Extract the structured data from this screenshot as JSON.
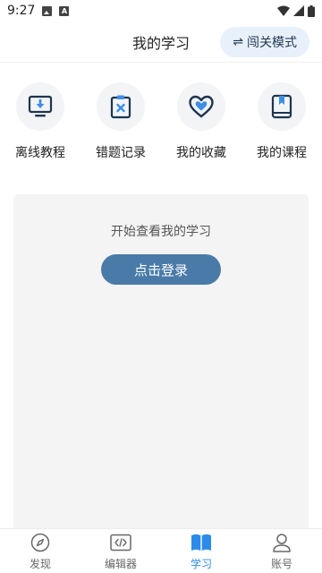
{
  "status_bar": {
    "time": "9:27"
  },
  "header": {
    "title": "我的学习",
    "mode_button_label": "闯关模式"
  },
  "quick_actions": [
    {
      "label": "离线教程",
      "icon": "download-screen-icon"
    },
    {
      "label": "错题记录",
      "icon": "clipboard-x-icon"
    },
    {
      "label": "我的收藏",
      "icon": "heart-icon"
    },
    {
      "label": "我的课程",
      "icon": "book-icon"
    }
  ],
  "login_card": {
    "hint": "开始查看我的学习",
    "button_label": "点击登录"
  },
  "bottom_nav": {
    "items": [
      {
        "label": "发现",
        "icon": "compass-icon",
        "active": false
      },
      {
        "label": "编辑器",
        "icon": "code-icon",
        "active": false
      },
      {
        "label": "学习",
        "icon": "book-open-icon",
        "active": true
      },
      {
        "label": "账号",
        "icon": "user-icon",
        "active": false
      }
    ]
  },
  "colors": {
    "accent": "#2c8be8",
    "login_button": "#4a7ba8",
    "mode_button_bg": "#e8f1fb",
    "icon_dark": "#1f3550",
    "card_bg": "#f4f4f4"
  }
}
